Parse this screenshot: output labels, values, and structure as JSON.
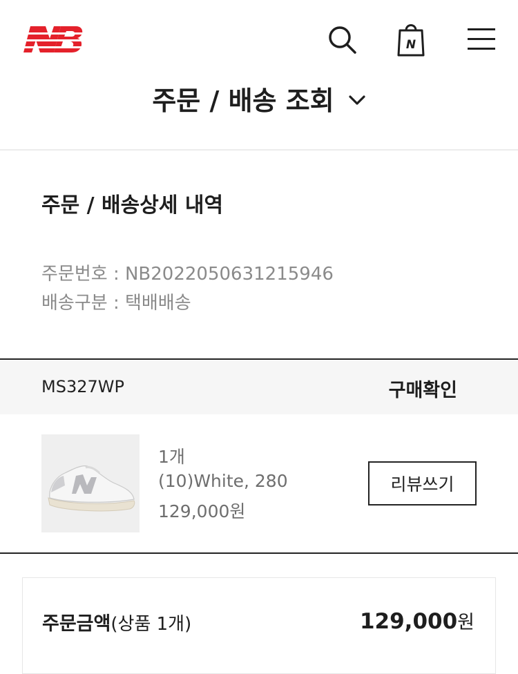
{
  "header": {
    "logo_alt": "NB",
    "icons": [
      "search-icon",
      "shopping-bag-icon",
      "hamburger-menu-icon"
    ],
    "bag_letter": "N"
  },
  "page": {
    "title": "주문 / 배송 조회"
  },
  "detail": {
    "section_title": "주문 / 배송상세 내역",
    "order_number": "주문번호 : NB2022050631215946",
    "delivery_type": "배송구분 : 택배배송"
  },
  "item": {
    "model_code": "MS327WP",
    "status": "구매확인",
    "quantity": "1개",
    "option": "(10)White, 280",
    "price": "129,000원",
    "review_button": "리뷰쓰기"
  },
  "summary": {
    "label_bold": "주문금액",
    "label_rest": "(상품 1개)",
    "amount_number": "129,000",
    "amount_unit": "원"
  },
  "colors": {
    "brand_red": "#e4212b",
    "text_dark": "#1e1e1e",
    "text_gray": "#8a8a8a"
  }
}
